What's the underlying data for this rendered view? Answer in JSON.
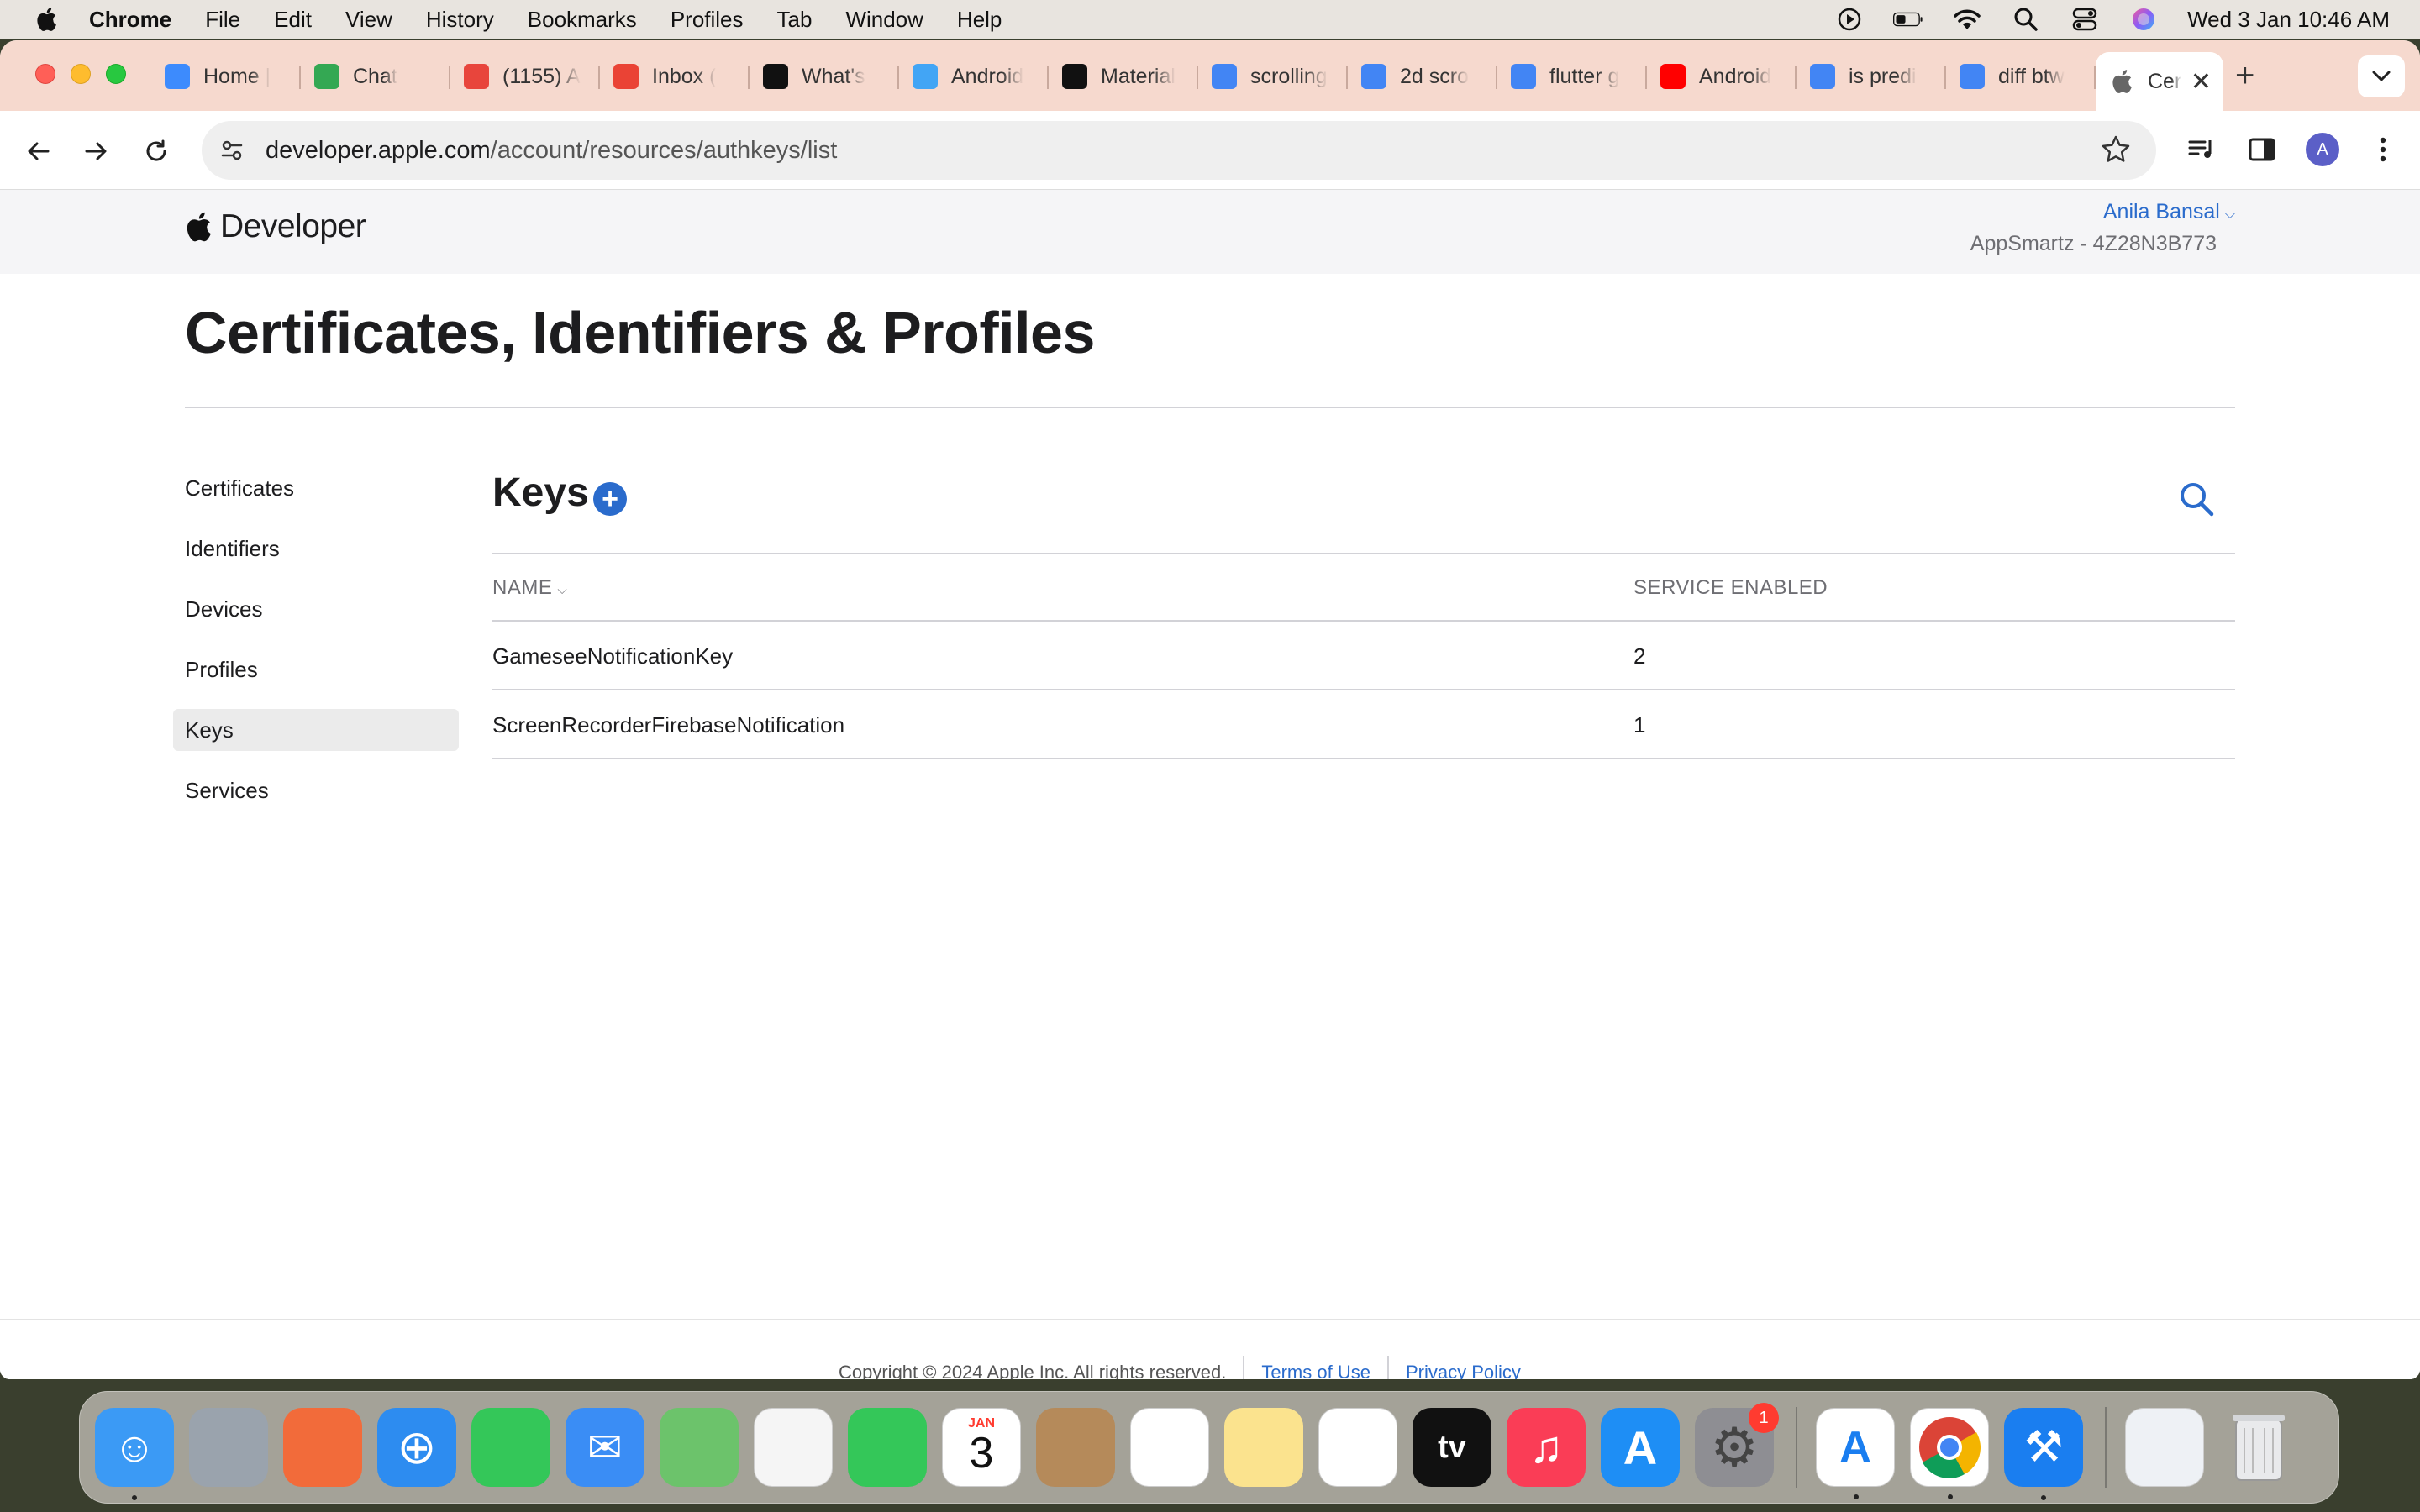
{
  "menubar": {
    "app_name": "Chrome",
    "items": [
      "File",
      "Edit",
      "View",
      "History",
      "Bookmarks",
      "Profiles",
      "Tab",
      "Window",
      "Help"
    ],
    "clock": "Wed 3 Jan  10:46 AM"
  },
  "browser": {
    "tabs": [
      {
        "label": "Home |",
        "icon": "k-icon",
        "color": "#3d8bfd"
      },
      {
        "label": "Chat",
        "icon": "chat-icon",
        "color": "#34a853"
      },
      {
        "label": "(1155) A",
        "icon": "task-icon",
        "color": "#e8453c"
      },
      {
        "label": "Inbox (",
        "icon": "gmail-icon",
        "color": "#ea4335"
      },
      {
        "label": "What's",
        "icon": "medium-icon",
        "color": "#111111"
      },
      {
        "label": "Android",
        "icon": "flutter-icon",
        "color": "#42a5f5"
      },
      {
        "label": "Material",
        "icon": "medium-icon",
        "color": "#111111"
      },
      {
        "label": "scrolling",
        "icon": "google-icon",
        "color": "#4285f4"
      },
      {
        "label": "2d scro",
        "icon": "google-icon",
        "color": "#4285f4"
      },
      {
        "label": "flutter g",
        "icon": "google-icon",
        "color": "#4285f4"
      },
      {
        "label": "Android",
        "icon": "youtube-icon",
        "color": "#ff0000"
      },
      {
        "label": "is predi",
        "icon": "google-icon",
        "color": "#4285f4"
      },
      {
        "label": "diff btw",
        "icon": "google-icon",
        "color": "#4285f4"
      }
    ],
    "active_tab": {
      "label": "Cer",
      "icon": "apple-icon"
    },
    "url_domain": "developer.apple.com",
    "url_path": "/account/resources/authkeys/list",
    "profile_initial": "A"
  },
  "header": {
    "brand": "Developer",
    "account_name": "Anila Bansal",
    "team": "AppSmartz - 4Z28N3B773"
  },
  "page_title": "Certificates, Identifiers & Profiles",
  "sidebar": {
    "items": [
      {
        "label": "Certificates",
        "active": false
      },
      {
        "label": "Identifiers",
        "active": false
      },
      {
        "label": "Devices",
        "active": false
      },
      {
        "label": "Profiles",
        "active": false
      },
      {
        "label": "Keys",
        "active": true
      },
      {
        "label": "Services",
        "active": false
      }
    ]
  },
  "main": {
    "heading": "Keys",
    "add_symbol": "+",
    "table": {
      "columns": [
        "NAME",
        "SERVICE ENABLED"
      ],
      "rows": [
        {
          "name": "GameseeNotificationKey",
          "services": "2"
        },
        {
          "name": "ScreenRecorderFirebaseNotification",
          "services": "1"
        }
      ]
    }
  },
  "footer": {
    "copyright": "Copyright © 2024 Apple Inc. All rights reserved.",
    "terms": "Terms of Use",
    "privacy": "Privacy Policy"
  },
  "dock": {
    "apps": [
      {
        "name": "finder",
        "color": "#3b9af5",
        "running": true
      },
      {
        "name": "launchpad",
        "color": "#9aa3ad",
        "running": false
      },
      {
        "name": "pen-app",
        "color": "#f26b3a",
        "running": false
      },
      {
        "name": "safari",
        "color": "#2d8cf0",
        "running": false
      },
      {
        "name": "messages",
        "color": "#34c759",
        "running": false
      },
      {
        "name": "mail",
        "color": "#3a8df5",
        "running": false
      },
      {
        "name": "maps",
        "color": "#6cc36b",
        "running": false
      },
      {
        "name": "photos",
        "color": "#f5f5f5",
        "running": false
      },
      {
        "name": "facetime",
        "color": "#34c759",
        "running": false
      },
      {
        "name": "calendar",
        "color": "#ffffff",
        "running": false
      },
      {
        "name": "contacts",
        "color": "#b58a5a",
        "running": false
      },
      {
        "name": "reminders",
        "color": "#ffffff",
        "running": false
      },
      {
        "name": "notes",
        "color": "#fbe38e",
        "running": false
      },
      {
        "name": "freeform",
        "color": "#ffffff",
        "running": false
      },
      {
        "name": "tv",
        "color": "#111111",
        "running": false
      },
      {
        "name": "music",
        "color": "#fa3d56",
        "running": false
      },
      {
        "name": "app-store",
        "color": "#1e8ef5",
        "running": false
      },
      {
        "name": "system-settings",
        "color": "#8e8e93",
        "running": false
      }
    ],
    "calendar_month": "JAN",
    "calendar_day": "3",
    "settings_badge": "1",
    "tv_label": "tv",
    "running_apps": [
      {
        "name": "instruments",
        "color": "#ffffff"
      },
      {
        "name": "chrome",
        "color": "#ffffff"
      },
      {
        "name": "xcode",
        "color": "#1a7ef0"
      }
    ]
  }
}
